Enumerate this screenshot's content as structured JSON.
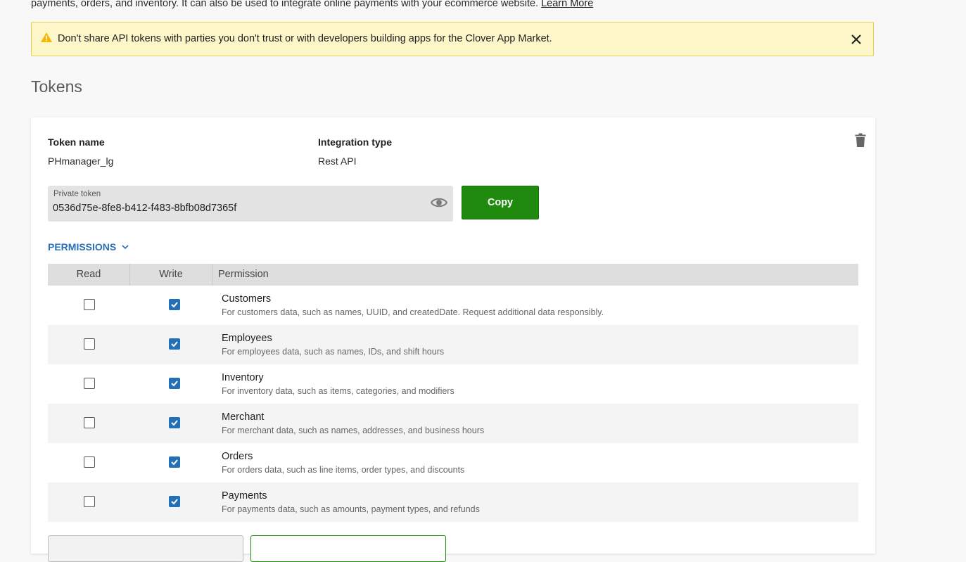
{
  "intro": {
    "text": "payments, orders, and inventory. It can also be used to integrate online payments with your ecommerce website.",
    "learn_more": "Learn More"
  },
  "alert": {
    "message": "Don't share API tokens with parties you don't trust or with developers building apps for the Clover App Market.",
    "icon": "warning-icon",
    "close_icon": "close-icon",
    "warning_color": "#f5b800"
  },
  "section": {
    "title": "Tokens"
  },
  "token": {
    "name_label": "Token name",
    "name_value": "PHmanager_lg",
    "type_label": "Integration type",
    "type_value": "Rest API",
    "private_label": "Private token",
    "private_value": "0536d75e-8fe8-b412-f483-8bfb08d7365f",
    "copy_label": "Copy"
  },
  "permissions": {
    "toggle_label": "PERMISSIONS",
    "headers": {
      "read": "Read",
      "write": "Write",
      "permission": "Permission"
    },
    "rows": [
      {
        "name": "Customers",
        "desc": "For customers data, such as names, UUID, and createdDate. Request additional data responsibly.",
        "read": false,
        "write": true
      },
      {
        "name": "Employees",
        "desc": "For employees data, such as names, IDs, and shift hours",
        "read": false,
        "write": true
      },
      {
        "name": "Inventory",
        "desc": "For inventory data, such as items, categories, and modifiers",
        "read": false,
        "write": true
      },
      {
        "name": "Merchant",
        "desc": "For merchant data, such as names, addresses, and business hours",
        "read": false,
        "write": true
      },
      {
        "name": "Orders",
        "desc": "For orders data, such as line items, order types, and discounts",
        "read": false,
        "write": true
      },
      {
        "name": "Payments",
        "desc": "For payments data, such as amounts, payment types, and refunds",
        "read": false,
        "write": true
      }
    ]
  },
  "colors": {
    "accent_green": "#1f8a0d",
    "link_blue": "#2a6fb5",
    "checkbox_blue": "#2270b5",
    "alert_bg": "#fdf6c8"
  }
}
